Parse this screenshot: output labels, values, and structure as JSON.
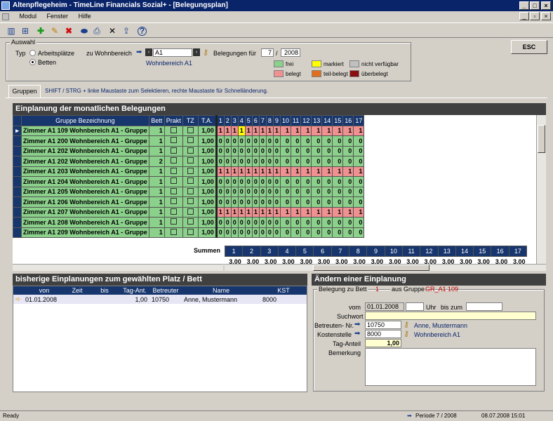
{
  "window": {
    "title": "Altenpflegeheim - TimeLine Financials Sozial+ - [Belegungsplan]"
  },
  "menu": [
    "Modul",
    "Fenster",
    "Hilfe"
  ],
  "auswahl": {
    "title": "Auswahl",
    "typ_label": "Typ",
    "opt_arbeitsplaetze": "Arbeitsplätze",
    "opt_betten": "Betten",
    "wohnbereich_label": "zu Wohnbereich",
    "wohnbereich_value": "A1",
    "wohnbereich_name": "Wohnbereich A1",
    "belegungen_label": "Belegungen für",
    "month": "7",
    "slash": "/",
    "year": "2008"
  },
  "legend": {
    "frei": "frei",
    "markiert": "markiert",
    "nicht_verfuegbar": "nicht verfügbar",
    "belegt": "belegt",
    "teil_belegt": "teil-belegt",
    "ueberbelegt": "überbelegt"
  },
  "esc_label": "ESC",
  "tab_label": "Gruppen",
  "hint": "SHIFT / STRG + linke Maustaste zum Selektieren, rechte Maustaste für Schnelländerung.",
  "grid": {
    "title": "Einplanung der monatlichen Belegungen",
    "headers": {
      "gruppe": "Gruppe Bezeichnung",
      "bett": "Bett",
      "prakt": "Prakt",
      "tz": "TZ",
      "ta": "T.A."
    },
    "days": [
      "1",
      "2",
      "3",
      "4",
      "5",
      "6",
      "7",
      "8",
      "9",
      "10",
      "11",
      "12",
      "13",
      "14",
      "15",
      "16",
      "17"
    ],
    "rows": [
      {
        "name": "Zimmer A1 109 Wohnbereich A1 - Gruppe",
        "bett": "1",
        "ta": "1,00",
        "v": "1",
        "status": "red"
      },
      {
        "name": "Zimmer A1 200 Wohnbereich A1 - Gruppe",
        "bett": "1",
        "ta": "1,00",
        "v": "0",
        "status": "green"
      },
      {
        "name": "Zimmer A1 202 Wohnbereich A1 - Gruppe",
        "bett": "1",
        "ta": "1,00",
        "v": "0",
        "status": "green"
      },
      {
        "name": "Zimmer A1 202 Wohnbereich A1 - Gruppe",
        "bett": "2",
        "ta": "1,00",
        "v": "0",
        "status": "green"
      },
      {
        "name": "Zimmer A1 203 Wohnbereich A1 - Gruppe",
        "bett": "1",
        "ta": "1,00",
        "v": "1",
        "status": "red"
      },
      {
        "name": "Zimmer A1 204 Wohnbereich A1 - Gruppe",
        "bett": "1",
        "ta": "1,00",
        "v": "0",
        "status": "green"
      },
      {
        "name": "Zimmer A1 205 Wohnbereich A1 - Gruppe",
        "bett": "1",
        "ta": "1,00",
        "v": "0",
        "status": "green"
      },
      {
        "name": "Zimmer A1 206 Wohnbereich A1 - Gruppe",
        "bett": "1",
        "ta": "1,00",
        "v": "0",
        "status": "green"
      },
      {
        "name": "Zimmer A1 207 Wohnbereich A1 - Gruppe",
        "bett": "1",
        "ta": "1,00",
        "v": "1",
        "status": "red"
      },
      {
        "name": "Zimmer A1 208 Wohnbereich A1 - Gruppe",
        "bett": "1",
        "ta": "1,00",
        "v": "0",
        "status": "green"
      },
      {
        "name": "Zimmer A1 209 Wohnbereich A1 - Gruppe",
        "bett": "1",
        "ta": "1,00",
        "v": "0",
        "status": "green"
      }
    ],
    "highlight": {
      "row": 0,
      "day": 3
    },
    "summen_label": "Summen",
    "sums": [
      "3,00",
      "3,00",
      "3,00",
      "3,00",
      "3,00",
      "3,00",
      "3,00",
      "3,00",
      "3,00",
      "3,00",
      "3,00",
      "3,00",
      "3,00",
      "3,00",
      "3,00",
      "3,00",
      "3,00"
    ]
  },
  "bisherige": {
    "title": "bisherige Einplanungen zum gewählten Platz / Bett",
    "headers": [
      "von",
      "Zeit",
      "bis",
      "Tag-Ant.",
      "Betreuter",
      "Name",
      "KST"
    ],
    "rows": [
      {
        "von": "01.01.2008",
        "zeit": "",
        "bis": "",
        "tag": "1,00",
        "betreuter": "10750",
        "name": "Anne, Mustermann",
        "kst": "8000"
      }
    ]
  },
  "aendern": {
    "title": "Ändern einer Einplanung",
    "bett_label": "Belegung zu Bett",
    "bett_value": "1",
    "gruppe_label": "aus Gruppe",
    "gruppe_value": "GR_A1 109",
    "vom_label": "vom",
    "vom_value": "01.01.2008",
    "uhr_label": "Uhr",
    "bis_label": "bis zum",
    "suchwort_label": "Suchwort",
    "betreuten_label": "Betreuten- Nr.",
    "betreuten_value": "10750",
    "betreuten_name": "Anne, Mustermann",
    "kst_label": "Kostenstelle",
    "kst_value": "8000",
    "kst_name": "Wohnbereich A1",
    "tag_label": "Tag-Anteil",
    "tag_value": "1,00",
    "bemerkung_label": "Bemerkung"
  },
  "status": {
    "left": "Ready",
    "periode": "Periode 7 / 2008",
    "datetime": "08.07.2008 15:01"
  },
  "colors": {
    "green": "#8bd08b",
    "red": "#f09090",
    "header_blue": "#17366e",
    "title_blue": "#0a246a"
  }
}
